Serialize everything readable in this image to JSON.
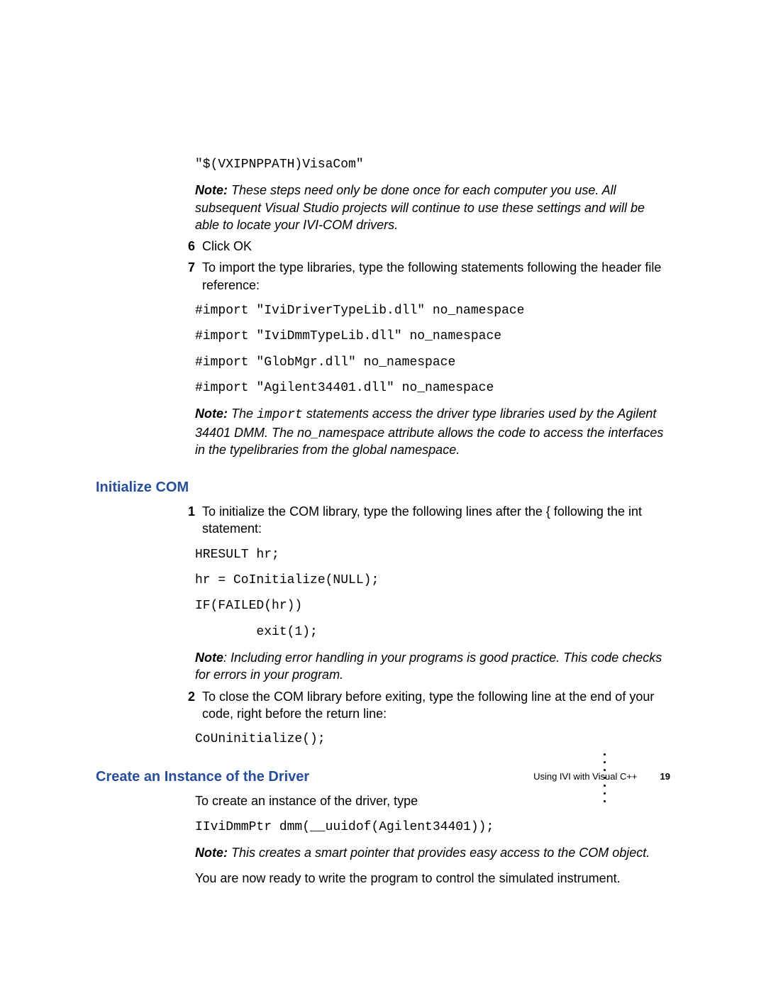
{
  "top": {
    "code0": "\"$(VXIPNPPATH)VisaCom\"",
    "note1_label": "Note:",
    "note1_body": " These steps need only be done once for each computer you use. All subsequent Visual Studio projects will continue to use these settings and will be able to locate your IVI-COM drivers."
  },
  "steps_a": [
    {
      "num": "6",
      "text": "Click OK"
    },
    {
      "num": "7",
      "text": "To import the type libraries, type the following statements following the header file reference:"
    }
  ],
  "imports": {
    "l1": "#import \"IviDriverTypeLib.dll\" no_namespace",
    "l2": "#import \"IviDmmTypeLib.dll\" no_namespace",
    "l3": "#import \"GlobMgr.dll\" no_namespace",
    "l4": "#import \"Agilent34401.dll\" no_namespace"
  },
  "note2": {
    "label": "Note:",
    "pre": " The ",
    "code": "import",
    "post": " statements access the driver type libraries used by the Agilent 34401 DMM. The no_namespace attribute allows the code to access the interfaces in the typelibraries from the global namespace."
  },
  "sec1": {
    "heading": "Initialize COM",
    "step1": {
      "num": "1",
      "text": "To initialize the COM library, type the following lines after the { following the int statement:"
    },
    "code": {
      "l1": "HRESULT hr;",
      "l2": "hr = CoInitialize(NULL);",
      "l3": "IF(FAILED(hr))",
      "l4": "        exit(1);"
    },
    "note": {
      "label": "Note",
      "body": ": Including error handling in your programs is good practice. This code checks for errors in your program."
    },
    "step2": {
      "num": "2",
      "text": "To close the COM library before exiting, type the following line at the end of your code, right before the return line:"
    },
    "code2": "CoUninitialize();"
  },
  "sec2": {
    "heading": "Create an Instance of the Driver",
    "p1": "To create an instance of the driver, type",
    "code": "IIviDmmPtr dmm(__uuidof(Agilent34401));",
    "note_label": "Note:",
    "note_body": "  This creates a smart pointer that provides easy access to the COM object.",
    "p2": "You are now ready to write the program to control the simulated instrument."
  },
  "footer": {
    "chapter": "Using IVI with Visual C++",
    "page": "19"
  }
}
